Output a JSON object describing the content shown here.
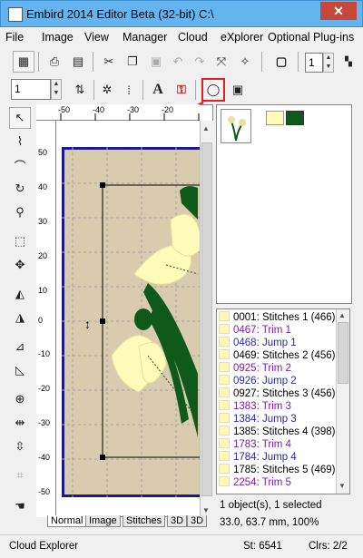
{
  "window": {
    "title": "Embird 2014 Editor Beta (32-bit)    C:\\",
    "close_glyph": "✕"
  },
  "menu": [
    "File",
    "Image",
    "View",
    "Manager",
    "Cloud",
    "eXplorer",
    "Optional Plug-ins"
  ],
  "toolbar1": {
    "spin_value": "1"
  },
  "toolbar2": {
    "spin_value": "1",
    "text_glyph": "A"
  },
  "ruler": {
    "h_ticks": [
      "-50",
      "-40",
      "-30",
      "-20"
    ],
    "v_ticks": [
      "50",
      "40",
      "30",
      "20",
      "10",
      "0",
      "-10",
      "-20",
      "-30",
      "-40",
      "-50"
    ]
  },
  "tabs": [
    "Normal",
    "Image",
    "Stitches",
    "3D",
    "3D"
  ],
  "colors": {
    "accent_highlight": "#e02020",
    "thread_1": "#fffbb8",
    "thread_2": "#0d5a1a",
    "hoop_border": "#1a1a8c",
    "fabric": "#d9ccae"
  },
  "object_list": [
    {
      "text": "0001:  Stitches 1 (466)",
      "kind": "s"
    },
    {
      "text": "0467:  Trim 1",
      "kind": "t"
    },
    {
      "text": "0468:  Jump 1",
      "kind": "j"
    },
    {
      "text": "0469:  Stitches 2 (456)",
      "kind": "s"
    },
    {
      "text": "0925:  Trim 2",
      "kind": "t"
    },
    {
      "text": "0926:  Jump 2",
      "kind": "j"
    },
    {
      "text": "0927:  Stitches 3 (456)",
      "kind": "s"
    },
    {
      "text": "1383:  Trim 3",
      "kind": "t"
    },
    {
      "text": "1384:  Jump 3",
      "kind": "j"
    },
    {
      "text": "1385:  Stitches 4 (398)",
      "kind": "s"
    },
    {
      "text": "1783:  Trim 4",
      "kind": "t"
    },
    {
      "text": "1784:  Jump 4",
      "kind": "j"
    },
    {
      "text": "1785:  Stitches 5 (469)",
      "kind": "s"
    },
    {
      "text": "2254:  Trim 5",
      "kind": "t"
    }
  ],
  "selection_info": "1 object(s), 1 selected",
  "coord_info": "33.0, 63.7 mm, 100%",
  "status": {
    "left": "Cloud Explorer",
    "stitches": "St: 6541",
    "colors": "Clrs: 2/2"
  }
}
